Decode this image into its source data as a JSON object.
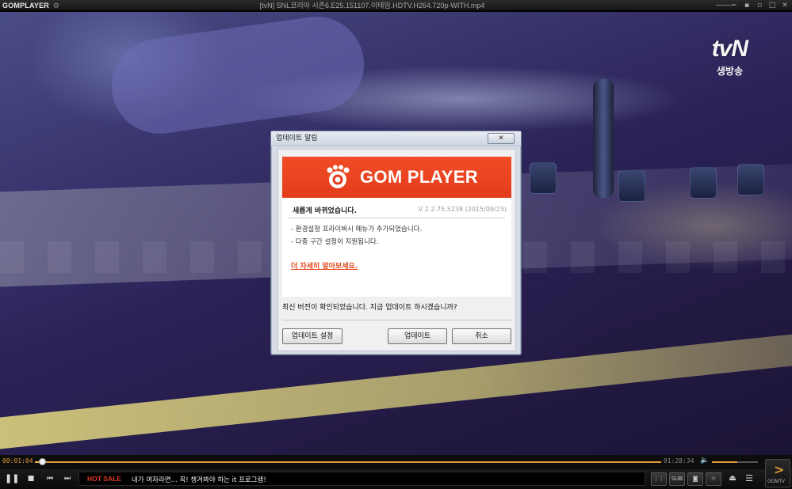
{
  "app": {
    "logo_text": "GOMPLAYER",
    "file_title": "[tvN] SNL코리아 시즌6.E25.151107.이태임.HDTV.H264.720p-WITH.mp4"
  },
  "window_controls": [
    "─",
    "▪",
    "▫",
    "□",
    "✕"
  ],
  "video": {
    "channel_logo": "tvN",
    "channel_sub": "생방송"
  },
  "dialog": {
    "title": "업데이트 알림",
    "close_label": "✕",
    "banner_text": "GOM PLAYER",
    "headline": "새롭게 바뀌었습니다.",
    "version": "V 2.2.75.5238 (2015/09/23)",
    "bullets": [
      "- 환경설정 프라이버시 메뉴가 추가되었습니다.",
      "- 다중 구간 설정이 지원됩니다."
    ],
    "more_link": "더 자세히 알아보세요.",
    "question": "최신 버전이 확인되었습니다. 지금 업데이트 하시겠습니까?",
    "buttons": {
      "settings": "업데이트 설정",
      "update": "업데이트",
      "cancel": "취소"
    },
    "colors": {
      "brand": "#f14c26",
      "link": "#e14a1e"
    }
  },
  "playback": {
    "current_time": "00:01:04",
    "total_time": "01:28:34",
    "progress_fraction": 0.012,
    "volume_fraction": 0.55,
    "accent_color": "#e09a3a"
  },
  "ticker": {
    "badge": "HOT SALE",
    "text": "내가 여자라면... 꼭! 챙겨봐야 하는 it 프로그램!"
  },
  "side_buttons": {
    "sub_label": "SUB",
    "gomtv_label": "GOMTV"
  }
}
